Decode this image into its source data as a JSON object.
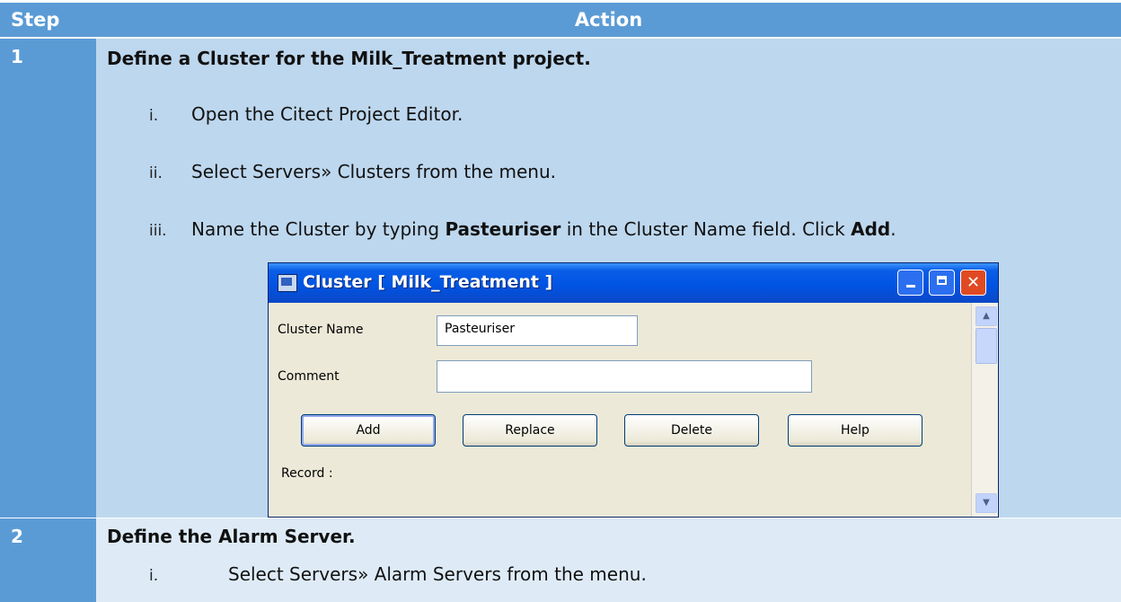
{
  "table": {
    "header": {
      "step": "Step",
      "action": "Action"
    },
    "rows": [
      {
        "step": "1",
        "heading": "Define a Cluster for the Milk_Treatment project.",
        "items": [
          {
            "num": "i.",
            "text": "Open the Citect Project Editor."
          },
          {
            "num": "ii.",
            "text": "Select Servers» Clusters from the menu."
          },
          {
            "num": "iii.",
            "pre": "Name the Cluster by typing ",
            "bold1": "Pasteuriser",
            "mid": " in the Cluster Name field. Click ",
            "bold2": "Add",
            "post": "."
          }
        ]
      },
      {
        "step": "2",
        "heading": "Define the Alarm Server.",
        "items": [
          {
            "num": "i.",
            "text": "Select Servers» Alarm Servers from the menu."
          }
        ]
      }
    ]
  },
  "dialog": {
    "title": "Cluster [ Milk_Treatment ]",
    "cluster_name_label": "Cluster Name",
    "cluster_name_value": "Pasteuriser",
    "comment_label": "Comment",
    "comment_value": "",
    "buttons": {
      "add": "Add",
      "replace": "Replace",
      "delete": "Delete",
      "help": "Help"
    },
    "record_label": "Record :",
    "window_buttons": {
      "close": "✕"
    }
  },
  "colors": {
    "header_blue": "#5b9bd5",
    "row1_bg": "#bdd7ee",
    "row2_bg": "#deebf7",
    "titlebar": "#0054e3",
    "dialog_bg": "#ece9d8"
  }
}
